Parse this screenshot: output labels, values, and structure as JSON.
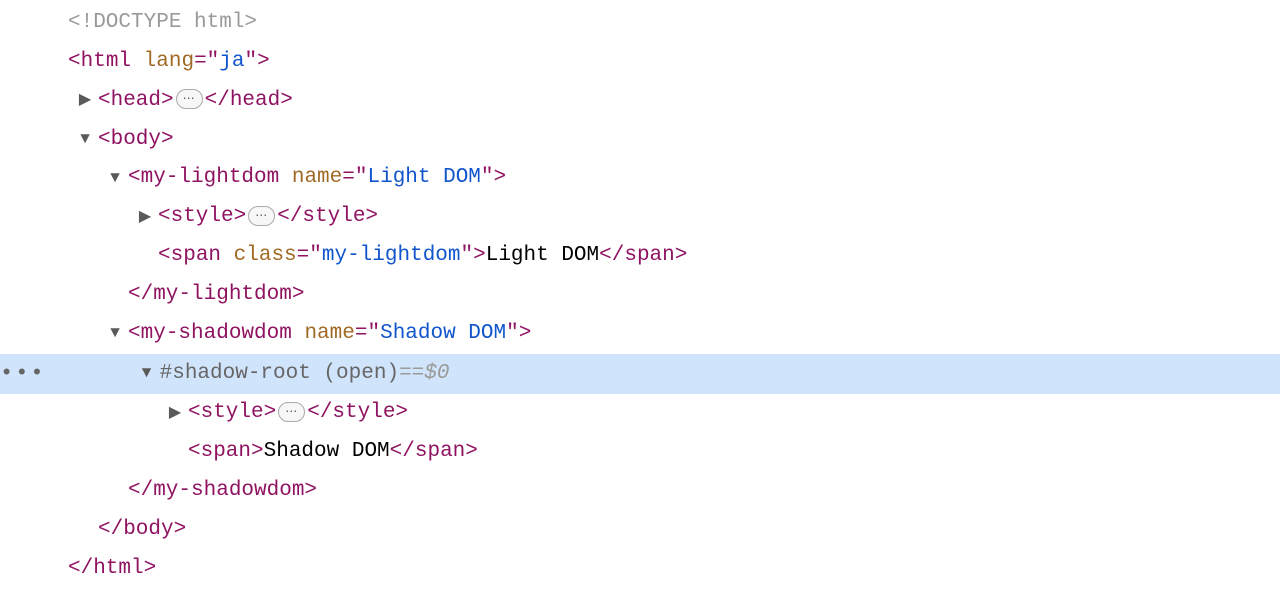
{
  "colors": {
    "selected_bg": "#d0e4fc",
    "tag": "#8f1361",
    "attr": "#a06a25",
    "string": "#1155cc",
    "faded": "#9a9a9a"
  },
  "gutter": {
    "more": "•••"
  },
  "ellipsis_pill": "⋯",
  "selection_suffix": {
    "eq": " == ",
    "dollar": "$0"
  },
  "dom": {
    "doctype": "<!DOCTYPE html>",
    "html_open": {
      "lt": "<",
      "tag": "html",
      "sp": " ",
      "attr": "lang",
      "eq": "=\"",
      "val": "ja",
      "end": "\">"
    },
    "html_close": "</html>",
    "head": {
      "open": "<head>",
      "close": "</head>"
    },
    "body": {
      "open": "<body>",
      "close": "</body>"
    },
    "lightdom": {
      "open": {
        "lt": "<",
        "tag": "my-lightdom",
        "sp": " ",
        "attr": "name",
        "eq": "=\"",
        "val": "Light DOM",
        "end": "\">"
      },
      "close": "</my-lightdom>",
      "style": {
        "open": "<style>",
        "close": "</style>"
      },
      "span": {
        "open_lt": "<",
        "open_tag": "span",
        "open_sp": " ",
        "open_attr": "class",
        "open_eq": "=\"",
        "open_val": "my-lightdom",
        "open_end": "\">",
        "text": "Light DOM",
        "close": "</span>"
      }
    },
    "shadowdom": {
      "open": {
        "lt": "<",
        "tag": "my-shadowdom",
        "sp": " ",
        "attr": "name",
        "eq": "=\"",
        "val": "Shadow DOM",
        "end": "\">"
      },
      "close": "</my-shadowdom>",
      "shadow_root": "#shadow-root (open)",
      "style": {
        "open": "<style>",
        "close": "</style>"
      },
      "span": {
        "open": "<span>",
        "text": "Shadow DOM",
        "close": "</span>"
      }
    }
  }
}
